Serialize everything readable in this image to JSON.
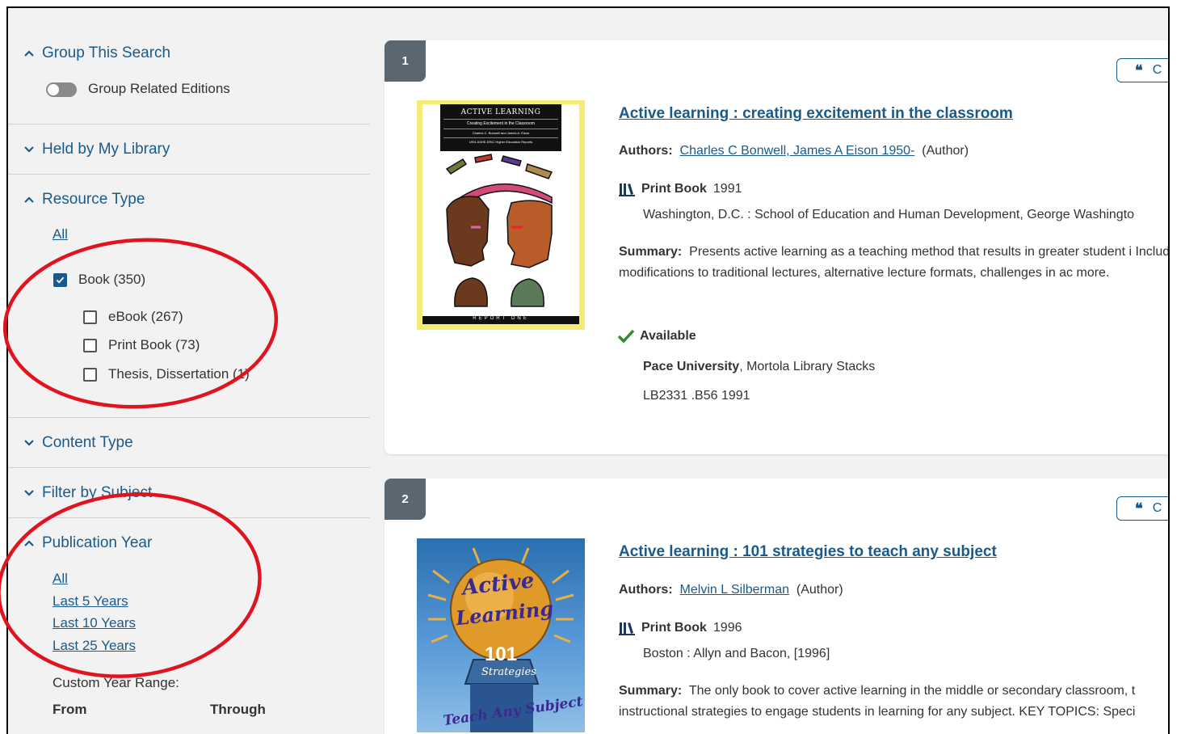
{
  "sidebar": {
    "group_search": {
      "heading": "Group This Search",
      "toggle_label": "Group Related Editions"
    },
    "held_by": {
      "heading": "Held by My Library"
    },
    "resource_type": {
      "heading": "Resource Type",
      "all_link": "All",
      "book": "Book (350)",
      "sub": [
        "eBook (267)",
        "Print Book (73)",
        "Thesis, Dissertation (1)"
      ]
    },
    "content_type": {
      "heading": "Content Type"
    },
    "subject": {
      "heading": "Filter by Subject"
    },
    "pub_year": {
      "heading": "Publication Year",
      "links": [
        "All",
        "Last 5 Years",
        "Last 10 Years",
        "Last 25 Years"
      ],
      "custom_label": "Custom Year Range:",
      "from_label": "From",
      "through_label": "Through"
    }
  },
  "results": [
    {
      "number": "1",
      "title": "Active learning : creating excitement in the classroom",
      "authors_label": "Authors:",
      "authors": "Charles C Bonwell, James A Eison 1950-",
      "author_role": "(Author)",
      "format": "Print Book",
      "year": "1991",
      "publisher": "Washington, D.C. : School of Education and Human Development, George Washingto",
      "summary_label": "Summary:",
      "summary": "Presents active learning as a teaching method that results in greater student i Includes modifications to traditional lectures, alternative lecture formats, challenges in ac more.",
      "availability": "Available",
      "library": "Pace University",
      "location": ", Mortola Library Stacks",
      "call_number": "LB2331 .B56 1991",
      "cover": {
        "header": "ACTIVE LEARNING",
        "sub1": "Creating Excitement in the Classroom",
        "sub2": "Charles C. Bonwell and James A. Eison",
        "sub3": "1991 ASHE-ERIC Higher Education Reports",
        "footer": "REPORT ONE"
      }
    },
    {
      "number": "2",
      "title": "Active learning : 101 strategies to teach any subject",
      "authors_label": "Authors:",
      "authors": "Melvin L Silberman",
      "author_role": "(Author)",
      "format": "Print Book",
      "year": "1996",
      "publisher": "Boston : Allyn and Bacon, [1996]",
      "summary_label": "Summary:",
      "summary": "The only book to cover active learning in the middle or secondary classroom, t instructional strategies to engage students in learning for any subject. KEY TOPICS: Speci",
      "cover": {
        "line1": "Active",
        "line2": "Learning",
        "line3": "101",
        "line4": "Strategies",
        "line5": "Teach Any Subject"
      }
    }
  ],
  "cite_label": "C",
  "colors": {
    "link": "#1a5a8a",
    "annotation": "#e0141e",
    "badge": "#5b6770",
    "available": "#2e8b2e"
  }
}
